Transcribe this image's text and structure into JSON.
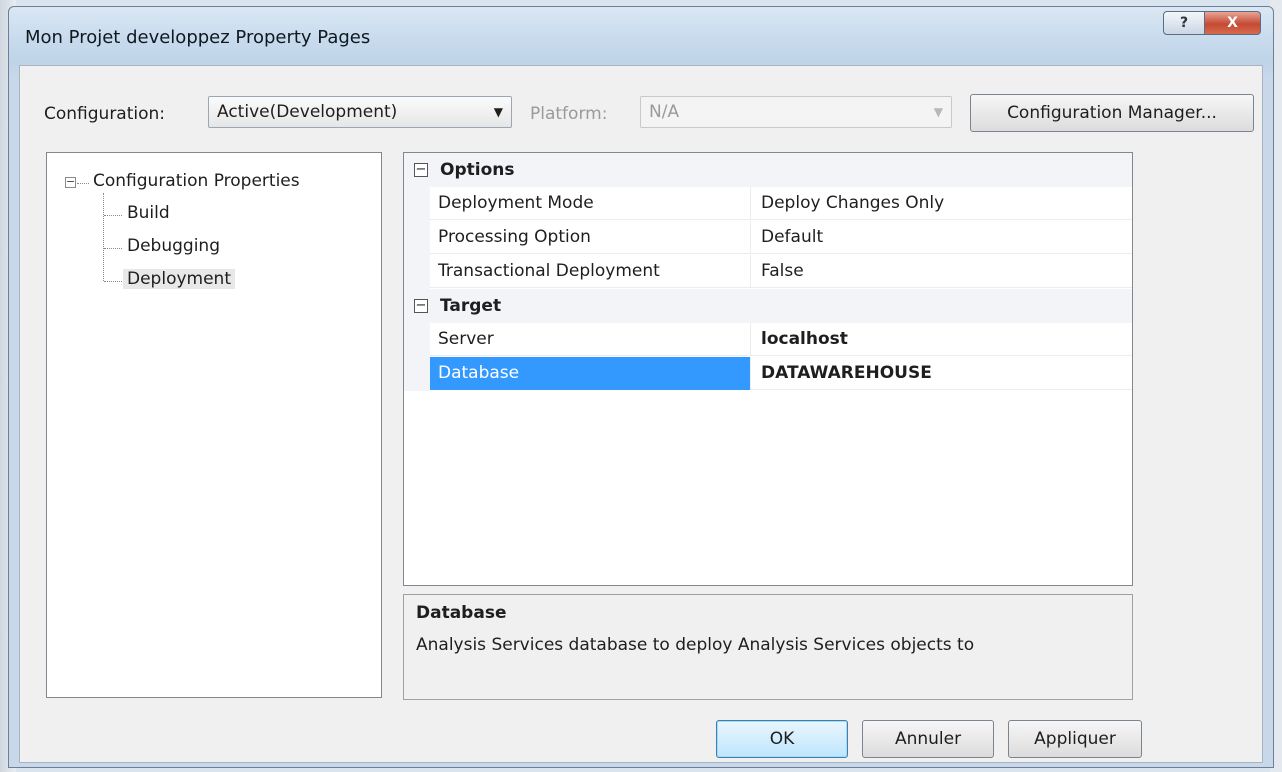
{
  "window": {
    "title": "Mon Projet developpez Property Pages",
    "help_glyph": "?",
    "close_glyph": "X"
  },
  "toolbar": {
    "configuration_label": "Configuration:",
    "configuration_value": "Active(Development)",
    "platform_label": "Platform:",
    "platform_value": "N/A",
    "dropdown_glyph": "▼",
    "configuration_manager_label": "Configuration Manager..."
  },
  "tree": {
    "root": {
      "label": "Configuration Properties",
      "expander": "−"
    },
    "children": [
      {
        "label": "Build"
      },
      {
        "label": "Debugging"
      },
      {
        "label": "Deployment"
      }
    ]
  },
  "grid": {
    "collapse_glyph": "−",
    "categories": [
      {
        "name": "Options",
        "properties": [
          {
            "name": "Deployment Mode",
            "value": "Deploy Changes Only"
          },
          {
            "name": "Processing Option",
            "value": "Default"
          },
          {
            "name": "Transactional Deployment",
            "value": "False"
          }
        ]
      },
      {
        "name": "Target",
        "properties": [
          {
            "name": "Server",
            "value": "localhost"
          },
          {
            "name": "Database",
            "value": "DATAWAREHOUSE"
          }
        ]
      }
    ]
  },
  "description": {
    "title": "Database",
    "text": "Analysis Services database to deploy Analysis Services objects to"
  },
  "buttons": {
    "ok": "OK",
    "cancel": "Annuler",
    "apply": "Appliquer"
  },
  "colors": {
    "selection": "#3399ff",
    "close_button": "#c44a33"
  }
}
